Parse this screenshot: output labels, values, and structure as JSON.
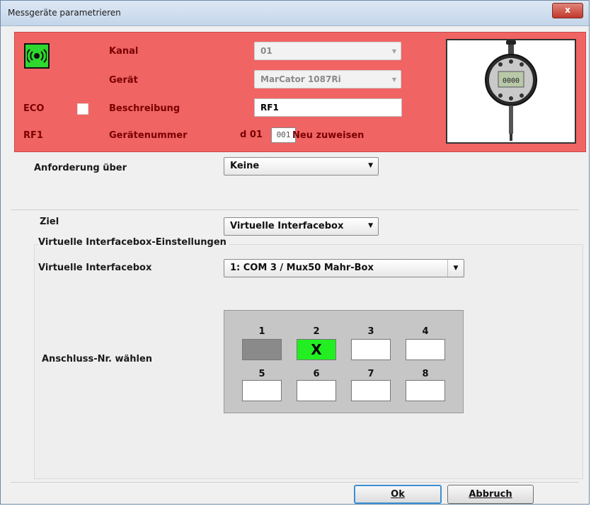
{
  "window": {
    "title": "Messgeräte parametrieren",
    "close_label": "x"
  },
  "device": {
    "kanal_label": "Kanal",
    "kanal_value": "01",
    "geraet_label": "Gerät",
    "geraet_value": "MarCator 1087Ri",
    "eco_label": "ECO",
    "eco_checked": false,
    "beschreibung_label": "Beschreibung",
    "beschreibung_value": "RF1",
    "rf_label": "RF1",
    "geraetenummer_label": "Gerätenummer",
    "geraetenummer_prefix": "d 01",
    "geraetenummer_value": "001",
    "neu_zuweisen_label": "Neu zuweisen",
    "gauge_display": "0000",
    "panel_color": "#f06464",
    "signal_color": "#2ed82e"
  },
  "request": {
    "label": "Anforderung über",
    "value": "Keine"
  },
  "target": {
    "ziel_label": "Ziel",
    "ziel_value": "Virtuelle Interfacebox",
    "group_title": "Virtuelle Interfacebox-Einstellungen",
    "box_label": "Virtuelle Interfacebox",
    "box_value": "1: COM 3 / Mux50 Mahr-Box",
    "port_label": "Anschluss-Nr. wählen",
    "ports": [
      {
        "number": "1",
        "mark": "",
        "state": "disabled"
      },
      {
        "number": "2",
        "mark": "X",
        "state": "selected"
      },
      {
        "number": "3",
        "mark": "",
        "state": "free"
      },
      {
        "number": "4",
        "mark": "",
        "state": "free"
      },
      {
        "number": "5",
        "mark": "",
        "state": "free"
      },
      {
        "number": "6",
        "mark": "",
        "state": "free"
      },
      {
        "number": "7",
        "mark": "",
        "state": "free"
      },
      {
        "number": "8",
        "mark": "",
        "state": "free"
      }
    ],
    "colors": {
      "selected": "#22ee22",
      "disabled": "#8a8a8a",
      "free": "#ffffff"
    }
  },
  "buttons": {
    "ok_label": "Ok",
    "cancel_label": "Abbruch"
  }
}
